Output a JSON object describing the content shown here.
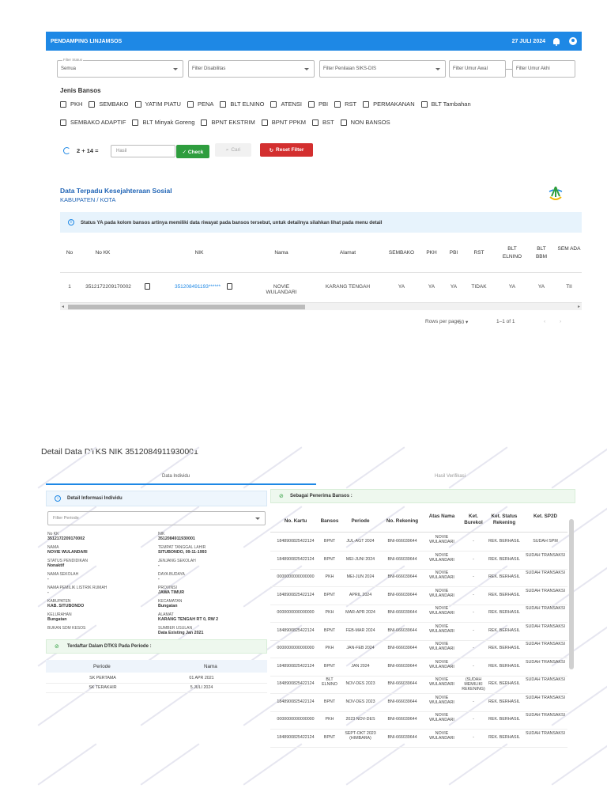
{
  "header": {
    "app_title": "PENDAMPING LINJAMSOS",
    "date": "27 JULI 2024",
    "bell_icon": "bell-icon",
    "account_icon": "account-icon",
    "color": "#1e88e5"
  },
  "filters": {
    "status_label": "Filter Status",
    "status_value": "Semua",
    "disabilitas_placeholder": "Filter Disabilitas",
    "penilaian_placeholder": "Filter Penilaian SIKS-DIS",
    "umur_awal_placeholder": "Filter Umur Awal",
    "umur_akhir_placeholder": "Filter Umur Akhi"
  },
  "jenis_bansos": {
    "title": "Jenis Bansos",
    "row1": [
      "PKH",
      "SEMBAKO",
      "YATIM PIATU",
      "PENA",
      "BLT ELNINO",
      "ATENSI",
      "PBI",
      "RST",
      "PERMAKANAN",
      "BLT Tambahan"
    ],
    "row2": [
      "SEMBAKO ADAPTIF",
      "BLT Minyak Goreng",
      "BPNT EKSTRIM",
      "BPNT PPKM",
      "BST",
      "NON BANSOS"
    ]
  },
  "captcha": {
    "question": "2 + 14 =",
    "input_placeholder": "Hasil",
    "check_label": "✓ Check",
    "cari_label": "Cari",
    "reset_label": "Reset Filter"
  },
  "data_section": {
    "title": "Data Terpadu Kesejahteraan Sosial",
    "subtitle": "KABUPATEN / KOTA",
    "info_text": "Status YA pada kolom bansos artinya memiliki data riwayat pada bansos tersebut, untuk detailnya silahkan lihat pada menu detail"
  },
  "main_table": {
    "headers": [
      "No",
      "No KK",
      "NIK",
      "Nama",
      "Alamat",
      "SEMBAKO",
      "PKH",
      "PBI",
      "RST",
      "BLT ELNINO",
      "BLT BBM",
      "SEM ADA"
    ],
    "row": [
      "1",
      "3512172209170002",
      "351208491193******",
      "NOVIE WULANDARI",
      "KARANG TENGAH",
      "YA",
      "YA",
      "YA",
      "TIDAK",
      "YA",
      "YA",
      "TII"
    ],
    "rows_per_page_label": "Rows per page:",
    "rows_per_page_value": "50",
    "range": "1–1 of 1"
  },
  "detail": {
    "title": "Detail Data DTKS NIK 3512084911930001",
    "tab_individu": "Data Individu",
    "tab_verifikasi": "Hasil Verifikasi",
    "info_individu_title": "Detail Informasi Individu",
    "filter_periode": "Filter Periode",
    "fields": [
      {
        "label": "No KK",
        "value": "3512172209170002"
      },
      {
        "label": "NIK",
        "value": "3512084911930001"
      },
      {
        "label": "NAMA",
        "value": "NOVIE WULANDARI"
      },
      {
        "label": "TEMPAT TANGGAL LAHIR",
        "value": "SITUBONDO, 09-11-1993"
      },
      {
        "label": "STATUS PENDIDIKAN",
        "value": "Nonaktif"
      },
      {
        "label": "JENJANG SEKOLAH",
        "value": "-"
      },
      {
        "label": "NAMA SEKOLAH",
        "value": "-"
      },
      {
        "label": "DAYA BUDAYA",
        "value": "-"
      },
      {
        "label": "NAMA PEMILIK LISTRIK RUMAH",
        "value": "-"
      },
      {
        "label": "PROVINSI",
        "value": "JAWA TIMUR"
      },
      {
        "label": "KABUPATEN",
        "value": "KAB. SITUBONDO"
      },
      {
        "label": "KECAMATAN",
        "value": "Bungatan"
      },
      {
        "label": "KELURAHAN",
        "value": "Bungatan"
      },
      {
        "label": "ALAMAT",
        "value": "KARANG TENGAH RT 0, RW 2"
      },
      {
        "label": "BUKAN SDM KESOS",
        "value": ""
      },
      {
        "label": "SUMBER USULAN",
        "value": "Data Existing Jan 2021"
      }
    ],
    "terdaftar_title": "Terdaftar Dalam DTKS Pada Periode :",
    "periode_headers": [
      "Periode",
      "Nama"
    ],
    "periode_rows": [
      [
        "SK PERTAMA",
        "01 APR 2021"
      ],
      [
        "SK TERAKHIR",
        "5 JULI 2024"
      ]
    ],
    "penerima_title": "Sebagai Penerima Bansos :",
    "bansos_headers": [
      "No. Kartu",
      "Bansos",
      "Periode",
      "No. Rekening",
      "Atas Nama",
      "Ket. Burekol",
      "Ket. Status Rekening",
      "Ket. SP2D"
    ],
    "bansos_rows": [
      [
        "1848900825422124",
        "BPNT",
        "JUL-AGT 2024",
        "BNI-666039644",
        "NOVIE WULANDARI",
        "-",
        "REK. BERHASIL",
        "SUDAH SPM"
      ],
      [
        "1848900825422124",
        "BPNT",
        "MEI-JUNI 2024",
        "BNI-666039644",
        "NOVIE WULANDARI",
        "-",
        "REK. BERHASIL",
        "SUDAH TRANSAKSI"
      ],
      [
        "0000000000000000",
        "PKH",
        "MEI-JUN 2024",
        "BNI-666039644",
        "NOVIE WULANDARI",
        "-",
        "REK. BERHASIL",
        "SUDAH TRANSAKSI"
      ],
      [
        "1848900825422124",
        "BPNT",
        "APRIL 2024",
        "BNI-666039644",
        "NOVIE WULANDARI",
        "-",
        "REK. BERHASIL",
        "SUDAH TRANSAKSI"
      ],
      [
        "0000000000000000",
        "PKH",
        "MAR-APR 2024",
        "BNI-666039644",
        "NOVIE WULANDARI",
        "-",
        "REK. BERHASIL",
        "SUDAH TRANSAKSI"
      ],
      [
        "1848900825422124",
        "BPNT",
        "FEB-MAR 2024",
        "BNI-666039644",
        "NOVIE WULANDARI",
        "-",
        "REK. BERHASIL",
        "SUDAH TRANSAKSI"
      ],
      [
        "0000000000000000",
        "PKH",
        "JAN-FEB 2024",
        "BNI-666039644",
        "NOVIE WULANDARI",
        "-",
        "REK. BERHASIL",
        "SUDAH TRANSAKSI"
      ],
      [
        "1848900825422124",
        "BPNT",
        "JAN 2024",
        "BNI-666039644",
        "NOVIE WULANDARI",
        "-",
        "REK. BERHASIL",
        "SUDAH TRANSAKSI"
      ],
      [
        "1848900825422124",
        "BLT ELNINO",
        "NOV-DES 2023",
        "BNI-666039644",
        "NOVIE WULANDARI",
        "(SUDAH MEMILIKI REKENING)",
        "REK. BERHASIL",
        "SUDAH TRANSAKSI"
      ],
      [
        "1848900825422124",
        "BPNT",
        "NOV-DES 2023",
        "BNI-666039644",
        "NOVIE WULANDARI",
        "-",
        "REK. BERHASIL",
        "SUDAH TRANSAKSI"
      ],
      [
        "0000000000000000",
        "PKH",
        "2023 NOV-DES",
        "BNI-666039644",
        "NOVIE WULANDARI",
        "-",
        "REK. BERHASIL",
        "SUDAH TRANSAKSI"
      ],
      [
        "1848900825422124",
        "BPNT",
        "SEPT-OKT 2023 (HIMBARA)",
        "BNI-666039644",
        "NOVIE WULANDARI",
        "-",
        "REK. BERHASIL",
        "SUDAH TRANSAKSI"
      ]
    ]
  }
}
